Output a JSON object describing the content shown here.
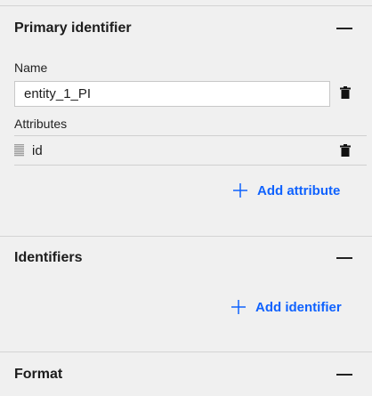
{
  "primary_identifier": {
    "title": "Primary identifier",
    "name_label": "Name",
    "name_value": "entity_1_PI",
    "attributes_label": "Attributes",
    "attributes": [
      {
        "name": "id"
      }
    ],
    "add_attribute_label": "Add attribute"
  },
  "identifiers": {
    "title": "Identifiers",
    "add_identifier_label": "Add identifier"
  },
  "format": {
    "title": "Format"
  },
  "colors": {
    "accent": "#0f62fe",
    "background": "#f0f0f0",
    "text": "#1c1c1c"
  }
}
